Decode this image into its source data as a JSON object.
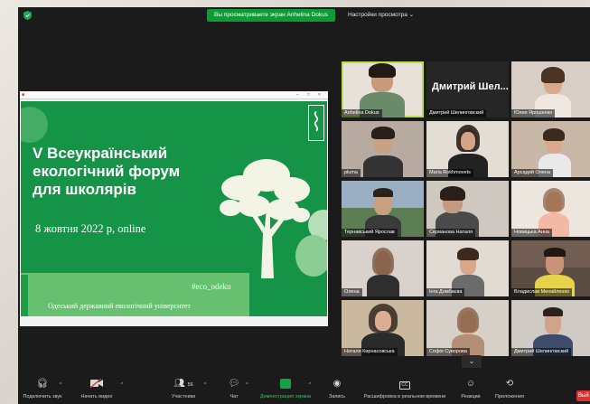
{
  "window": {
    "share_banner": "Вы просматриваете экран Anhelina Dokus",
    "view_options": "Настройки просмотра ⌄"
  },
  "slide": {
    "title_lines": [
      "V Всеукраїнський",
      "екологічний форум",
      "для школярів"
    ],
    "date": "8 жовтня 2022 р, online",
    "hashtag": "#eco_odeku",
    "university": "Одеський державний екологічний університет"
  },
  "gallery": {
    "big_name": "Дмитрий  Шел...",
    "participants": [
      "Anhelina Dokus",
      "Дмитрий Шелинговский",
      "Юлия Ярошенко",
      "pluma",
      "Maria Rokhmovets",
      "Арсадий Олена",
      "Тернавський Ярослав",
      "Серванова Наталя",
      "Новицька Анна",
      "Олена",
      "Інга Домбаєва",
      "Владислав Михайленко",
      "Наталя Кирнасовська",
      "Софія Суворова",
      "Дмитрий Шелинговский"
    ]
  },
  "toolbar": {
    "items": [
      {
        "label": "Подключить звук",
        "icon": "headphones-icon"
      },
      {
        "label": "Начать видео",
        "icon": "video-off-icon"
      },
      {
        "label": "Участники",
        "icon": "participants-icon",
        "count": "56"
      },
      {
        "label": "Чат",
        "icon": "chat-icon"
      },
      {
        "label": "Демонстрация экрана",
        "icon": "share-screen-icon"
      },
      {
        "label": "Запись",
        "icon": "record-icon"
      },
      {
        "label": "Расшифровка в реальном времени",
        "icon": "cc-icon"
      },
      {
        "label": "Реакции",
        "icon": "reaction-icon"
      },
      {
        "label": "Приложения",
        "icon": "apps-icon"
      }
    ],
    "leave": "Вый"
  }
}
